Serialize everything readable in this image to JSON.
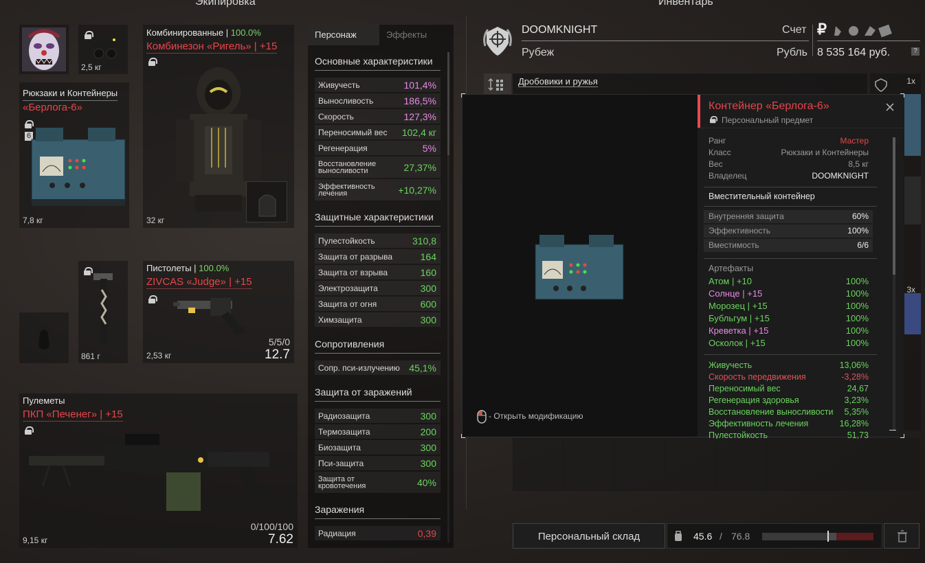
{
  "equipment": {
    "title": "Экипировка",
    "helmet_weight": "2,5 кг",
    "backpack": {
      "category": "Рюкзаки и Контейнеры",
      "name": "«Берлога-6»",
      "badge": "6",
      "weight": "7,8 кг"
    },
    "armor": {
      "category": "Комбинированные",
      "category_sep": " | ",
      "category_pct": "100.0%",
      "name": "Комбинезон «Ригель» | +15",
      "weight": "32 кг"
    },
    "melee_weight": "861 г",
    "pistol": {
      "category": "Пистолеты",
      "category_sep": " | ",
      "category_pct": "100.0%",
      "name": "ZIVCAS «Judge» | +15",
      "weight": "2,53 кг",
      "ammo": "5/5/0",
      "dps": "12.7"
    },
    "mg": {
      "category": "Пулеметы",
      "name": "ПКП «Печенег» | +15",
      "weight": "9,15 кг",
      "ammo": "0/100/100",
      "dps": "7.62"
    }
  },
  "stats": {
    "tab_character": "Персонаж",
    "tab_effects": "Эффекты",
    "main_header": "Основные характеристики",
    "main": [
      {
        "label": "Живучесть",
        "value": "101,4%",
        "color": "pink"
      },
      {
        "label": "Выносливость",
        "value": "186,5%",
        "color": "pink"
      },
      {
        "label": "Скорость",
        "value": "127,3%",
        "color": "pink"
      },
      {
        "label": "Переносимый вес",
        "value": "102,4 кг",
        "color": "green"
      },
      {
        "label": "Регенерация",
        "value": "5%",
        "color": "pink"
      },
      {
        "label": "Восстановление выносливости",
        "value": "27,37%",
        "color": "green"
      },
      {
        "label": "Эффективность лечения",
        "value": "+10,27%",
        "color": "green"
      }
    ],
    "defense_header": "Защитные характеристики",
    "defense": [
      {
        "label": "Пулестойкость",
        "value": "310,8"
      },
      {
        "label": "Защита от разрыва",
        "value": "164"
      },
      {
        "label": "Защита от взрыва",
        "value": "160"
      },
      {
        "label": "Электрозащита",
        "value": "300"
      },
      {
        "label": "Защита от огня",
        "value": "600"
      },
      {
        "label": "Химзащита",
        "value": "300"
      }
    ],
    "resist_header": "Сопротивления",
    "resist": [
      {
        "label": "Сопр. пси-излучению",
        "value": "45,1%"
      }
    ],
    "infect_def_header": "Защита от заражений",
    "infect_def": [
      {
        "label": "Радиозащита",
        "value": "300"
      },
      {
        "label": "Термозащита",
        "value": "200"
      },
      {
        "label": "Биозащита",
        "value": "300"
      },
      {
        "label": "Пси-защита",
        "value": "300"
      },
      {
        "label": "Защита от кровотечения",
        "value": "40%"
      }
    ],
    "infect_header": "Заражения",
    "infect": [
      {
        "label": "Радиация",
        "value": "0,39"
      }
    ]
  },
  "inventory": {
    "title": "Инвентарь",
    "player_name": "DOOMKNIGHT",
    "location": "Рубеж",
    "account_label": "Счет",
    "currency_label": "Рубль",
    "balance": "8 535 164 руб.",
    "currency_symbol": "₽",
    "filter_label": "Дробовики и ружья",
    "stack_1": "1x",
    "stack_3": "3x",
    "storage_button": "Персональный склад",
    "weight_current": "45.6",
    "weight_sep": "/",
    "weight_max": "76.8",
    "weight_fill": 0.594,
    "help": "?"
  },
  "tooltip": {
    "title": "Контейнер «Берлога-6»",
    "subtitle": "Персональный предмет",
    "info": [
      {
        "label": "Ранг",
        "value": "Мастер",
        "color": "red"
      },
      {
        "label": "Класс",
        "value": "Рюкзаки и Контейнеры"
      },
      {
        "label": "Вес",
        "value": "8,5 кг"
      },
      {
        "label": "Владелец",
        "value": "DOOMKNIGHT",
        "color": "white"
      }
    ],
    "type": "Вместительный контейнер",
    "container": [
      {
        "label": "Внутренняя защита",
        "value": "60%"
      },
      {
        "label": "Эффективность",
        "value": "100%"
      },
      {
        "label": "Вместимость",
        "value": "6/6"
      }
    ],
    "artifacts_header": "Артефакты",
    "artifacts": [
      {
        "name": "Атом | +10",
        "value": "100%",
        "color": "#6bd45f"
      },
      {
        "name": "Солнце | +15",
        "value": "100%",
        "color": "#e88ae6"
      },
      {
        "name": "Морозец | +15",
        "value": "100%",
        "color": "#6bd45f"
      },
      {
        "name": "Бубльгум | +15",
        "value": "100%",
        "color": "#6bd45f"
      },
      {
        "name": "Креветка | +15",
        "value": "100%",
        "color": "#e88ae6"
      },
      {
        "name": "Осколок | +15",
        "value": "100%",
        "color": "#6bd45f"
      }
    ],
    "bonuses": [
      {
        "label": "Живучесть",
        "value": "13,06%",
        "color": "#6bd45f"
      },
      {
        "label": "Скорость передвижения",
        "value": "-3,28%",
        "color": "#e0525a"
      },
      {
        "label": "Переносимый вес",
        "value": "24,67",
        "color": "#6bd45f"
      },
      {
        "label": "Регенерация здоровья",
        "value": "3,23%",
        "color": "#6bd45f"
      },
      {
        "label": "Восстановление выносливости",
        "value": "5,35%",
        "color": "#6bd45f"
      },
      {
        "label": "Эффективность лечения",
        "value": "16,28%",
        "color": "#6bd45f"
      },
      {
        "label": "Пулестойкость",
        "value": "51,73",
        "color": "#6bd45f"
      }
    ],
    "hint": "- Открыть модификацию"
  }
}
